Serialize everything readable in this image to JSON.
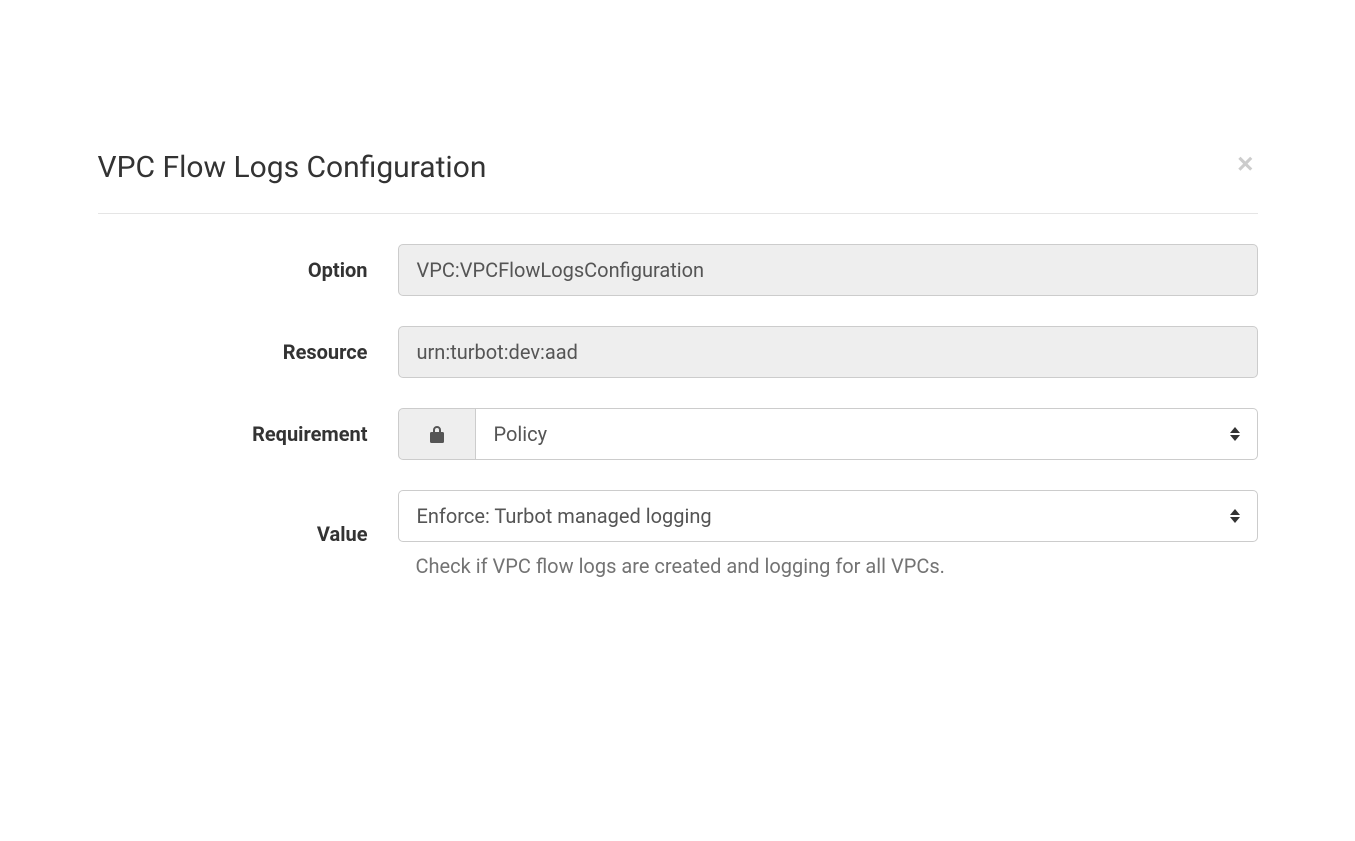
{
  "modal": {
    "title": "VPC Flow Logs Configuration"
  },
  "form": {
    "option": {
      "label": "Option",
      "value": "VPC:VPCFlowLogsConfiguration"
    },
    "resource": {
      "label": "Resource",
      "value": "urn:turbot:dev:aad"
    },
    "requirement": {
      "label": "Requirement",
      "selected": "Policy"
    },
    "value": {
      "label": "Value",
      "selected": "Enforce: Turbot managed logging",
      "help": "Check if VPC flow logs are created and logging for all VPCs."
    }
  }
}
